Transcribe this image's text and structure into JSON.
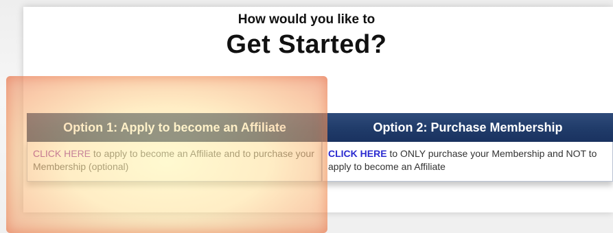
{
  "heading": {
    "small": "How would you like to",
    "big": "Get Started?"
  },
  "options": [
    {
      "title": "Option 1: Apply to become an Affiliate",
      "link_text": "CLICK HERE",
      "body_text": " to apply to become an Affiliate and to purchase your Membership (optional)"
    },
    {
      "title": "Option 2: Purchase Membership",
      "link_text": "CLICK HERE",
      "body_text": " to ONLY purchase your Membership and NOT to apply to become an Affiliate"
    }
  ],
  "colors": {
    "header_bg": "#1f3a68",
    "link_option1": "#8a1fa0",
    "link_option2": "#2a2ad0",
    "highlight": "#f5a064"
  }
}
